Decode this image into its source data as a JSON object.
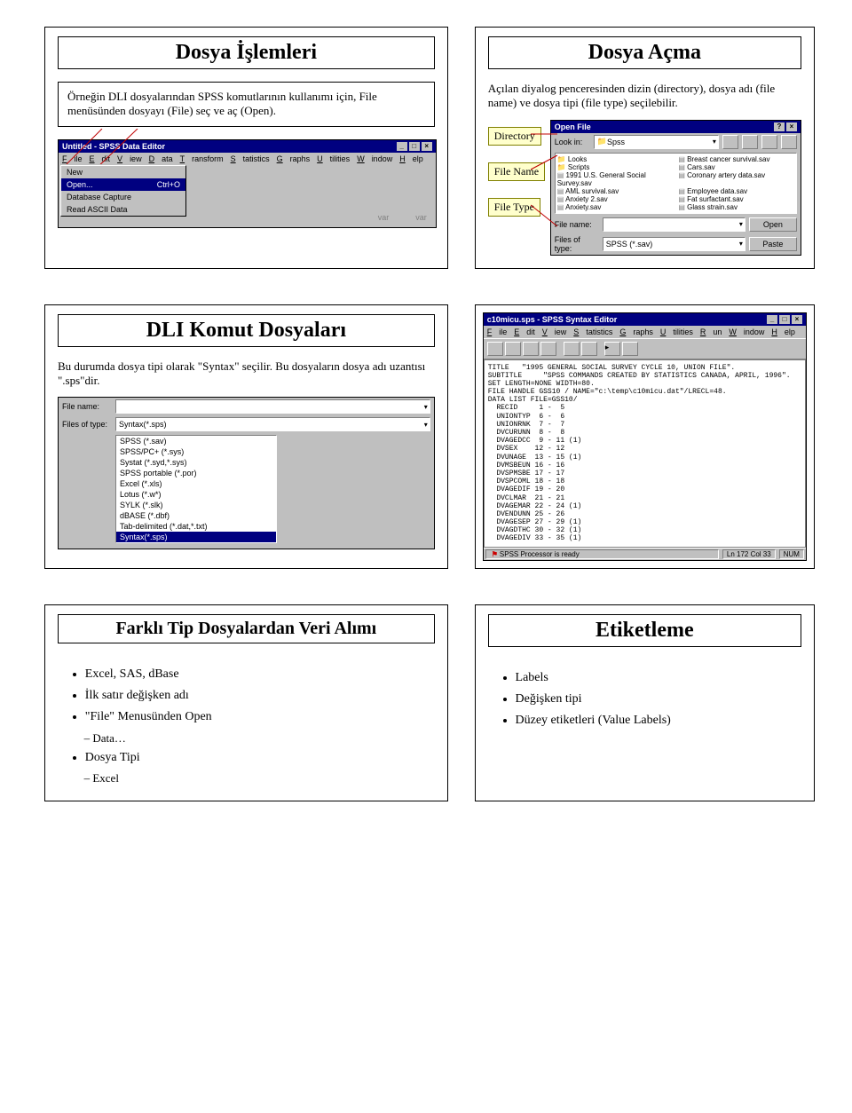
{
  "slide1": {
    "title": "Dosya İşlemleri",
    "body": "Örneğin DLI dosyalarından SPSS komutlarının kullanımı için, File menüsünden dosyayı (File) seç ve aç (Open).",
    "ss_title": "Untitled - SPSS Data Editor",
    "menu": [
      "File",
      "Edit",
      "View",
      "Data",
      "Transform",
      "Statistics",
      "Graphs",
      "Utilities",
      "Window",
      "Help"
    ],
    "dropdown_items": [
      {
        "label": "New",
        "accel": ""
      },
      {
        "label": "Open...",
        "accel": "Ctrl+O",
        "hl": true
      },
      {
        "label": "Database Capture",
        "accel": ""
      },
      {
        "label": "Read ASCII Data",
        "accel": ""
      }
    ],
    "var": "var"
  },
  "slide2": {
    "title": "Dosya Açma",
    "body": "Açılan diyalog penceresinden dizin (directory), dosya adı (file name) ve dosya tipi (file type) seçilebilir.",
    "labels": {
      "dir": "Directory",
      "fname": "File Name",
      "ftype": "File Type"
    },
    "dlg_title": "Open File",
    "lookin": "Look in:",
    "lookin_val": "Spss",
    "left": [
      "Looks",
      "Scripts",
      "1991 U.S. General Social Survey.sav",
      "AML survival.sav",
      "Anxiety 2.sav",
      "Anxiety.sav"
    ],
    "right": [
      "Breast cancer survival.sav",
      "Cars.sav",
      "Coronary artery data.sav",
      "Employee data.sav",
      "Fat surfactant.sav",
      "Glass strain.sav"
    ],
    "filename_lbl": "File name:",
    "filesof_lbl": "Files of type:",
    "filesof_val": "SPSS (*.sav)",
    "open": "Open",
    "paste": "Paste"
  },
  "slide3": {
    "title": "DLI Komut Dosyaları",
    "body": "Bu durumda dosya tipi olarak \"Syntax\" seçilir. Bu dosyaların dosya adı uzantısı \".sps\"dir.",
    "filename_lbl": "File name:",
    "filesof_lbl": "Files of type:",
    "top_val": "Syntax(*.sps)",
    "types": [
      "SPSS (*.sav)",
      "SPSS/PC+ (*.sys)",
      "Systat (*.syd,*.sys)",
      "SPSS portable (*.por)",
      "Excel (*.xls)",
      "Lotus (*.w*)",
      "SYLK (*.slk)",
      "dBASE (*.dbf)",
      "Tab-delimited (*.dat,*.txt)",
      "Syntax(*.sps)"
    ]
  },
  "slide4": {
    "ss_title": "c10micu.sps - SPSS Syntax Editor",
    "menu": [
      "File",
      "Edit",
      "View",
      "Statistics",
      "Graphs",
      "Utilities",
      "Run",
      "Window",
      "Help"
    ],
    "status_proc": "SPSS Processor is ready",
    "status_pos": "Ln 172 Col 33",
    "status_num": "NUM",
    "syntax": "TITLE   \"1995 GENERAL SOCIAL SURVEY CYCLE 10, UNION FILE\".\nSUBTITLE     \"SPSS COMMANDS CREATED BY STATISTICS CANADA, APRIL, 1996\".\nSET LENGTH=NONE WIDTH=80.\nFILE HANDLE GSS10 / NAME=\"c:\\temp\\c10micu.dat\"/LRECL=48.\nDATA LIST FILE=GSS10/\n  RECID     1 -  5\n  UNIONTYP  6 -  6\n  UNIONRNK  7 -  7\n  DVCURUNN  8 -  8\n  DVAGEDCC  9 - 11 (1)\n  DVSEX    12 - 12\n  DVUNAGE  13 - 15 (1)\n  DVMSBEUN 16 - 16\n  DVSPMSBE 17 - 17\n  DVSPCOML 18 - 18\n  DVAGEDIF 19 - 20\n  DVCLMAR  21 - 21\n  DVAGEMAR 22 - 24 (1)\n  DVENDUNN 25 - 26\n  DVAGESEP 27 - 29 (1)\n  DVAGDTHC 30 - 32 (1)\n  DVAGEDIV 33 - 35 (1)"
  },
  "slide5": {
    "title": "Farklı Tip Dosyalardan Veri Alımı",
    "bullets": [
      "Excel, SAS, dBase",
      "İlk satır değişken adı",
      "\"File\" Menusünden Open"
    ],
    "sub1": "Data…",
    "bullet4": "Dosya Tipi",
    "sub2": "Excel"
  },
  "slide6": {
    "title": "Etiketleme",
    "bullets": [
      "Labels",
      "Değişken tipi",
      "Düzey etiketleri (Value Labels)"
    ]
  }
}
